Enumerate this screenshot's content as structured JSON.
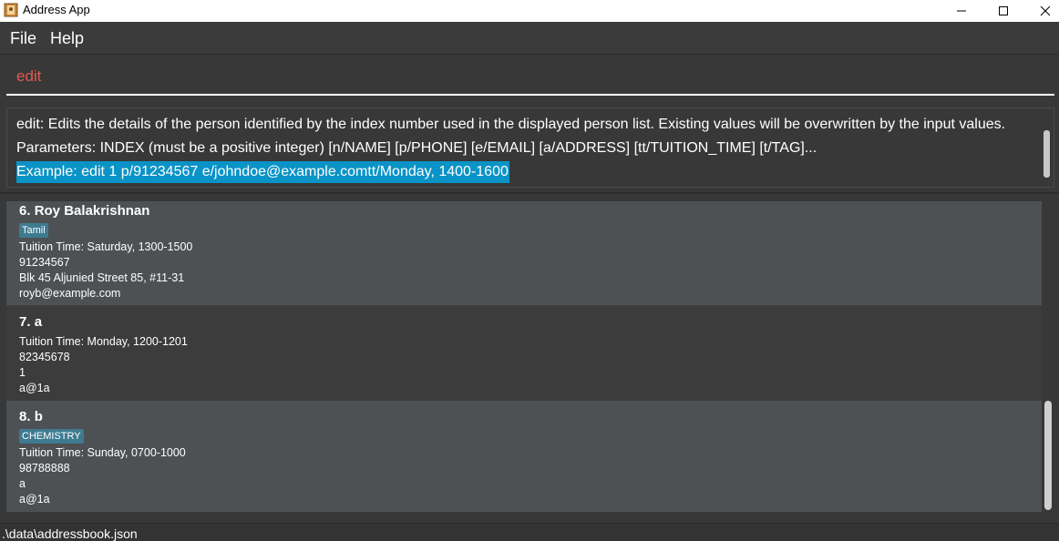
{
  "window": {
    "title": "Address App",
    "icons": {
      "app": "address-book-icon",
      "minimize": "minimize-icon",
      "maximize": "maximize-icon",
      "close": "close-icon"
    }
  },
  "menu": {
    "file": "File",
    "help": "Help"
  },
  "command": {
    "value": "edit"
  },
  "result": {
    "line1": "edit: Edits the details of the person identified by the index number used in the displayed person list. Existing values will be overwritten by the input values.",
    "line2": "Parameters: INDEX (must be a positive integer) [n/NAME] [p/PHONE] [e/EMAIL] [a/ADDRESS] [tt/TUITION_TIME] [t/TAG]...",
    "line3": "Example: edit 1 p/91234567 e/johndoe@example.comtt/Monday, 1400-1600"
  },
  "persons": [
    {
      "index": "6. ",
      "name": "Roy Balakrishnan",
      "tag": "Tamil",
      "tuition": "Tuition Time: Saturday, 1300-1500",
      "phone": "91234567",
      "address": "Blk 45 Aljunied Street 85, #11-31",
      "email": "royb@example.com"
    },
    {
      "index": "7. ",
      "name": "a",
      "tuition": "Tuition Time: Monday, 1200-1201",
      "phone": "82345678",
      "address": "1",
      "email": "a@1a"
    },
    {
      "index": "8. ",
      "name": "b",
      "tag": "CHEMISTRY",
      "tuition": "Tuition Time: Sunday, 0700-1000",
      "phone": "98788888",
      "address": "a",
      "email": "a@1a"
    }
  ],
  "status": {
    "path": ".\\data\\addressbook.json"
  },
  "colors": {
    "accent": "#0a93c6",
    "tag": "#3e7b91",
    "command_text": "#e05a4f",
    "background": "#383838"
  }
}
